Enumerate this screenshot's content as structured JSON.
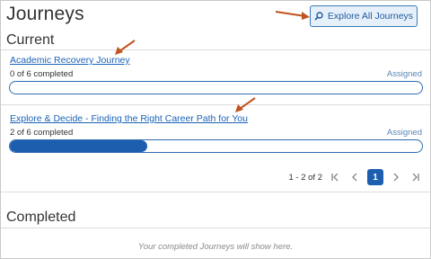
{
  "page": {
    "title": "Journeys",
    "explore_button": {
      "label": "Explore All Journeys",
      "icon": "search-icon"
    }
  },
  "current": {
    "heading": "Current",
    "journeys": [
      {
        "title": "Academic Recovery Journey",
        "progress_text": "0 of 6 completed",
        "status": "Assigned",
        "completed": 0,
        "total": 6
      },
      {
        "title": "Explore & Decide - Finding the Right Career Path for You",
        "progress_text": "2 of 6 completed",
        "status": "Assigned",
        "completed": 2,
        "total": 6
      }
    ],
    "pagination": {
      "range": "1 - 2 of 2",
      "current_page": "1"
    }
  },
  "completed": {
    "heading": "Completed",
    "empty_message": "Your completed Journeys will show here."
  },
  "colors": {
    "accent": "#1d5fae",
    "link": "#1a63b6",
    "annotation_arrow": "#c0531f"
  }
}
